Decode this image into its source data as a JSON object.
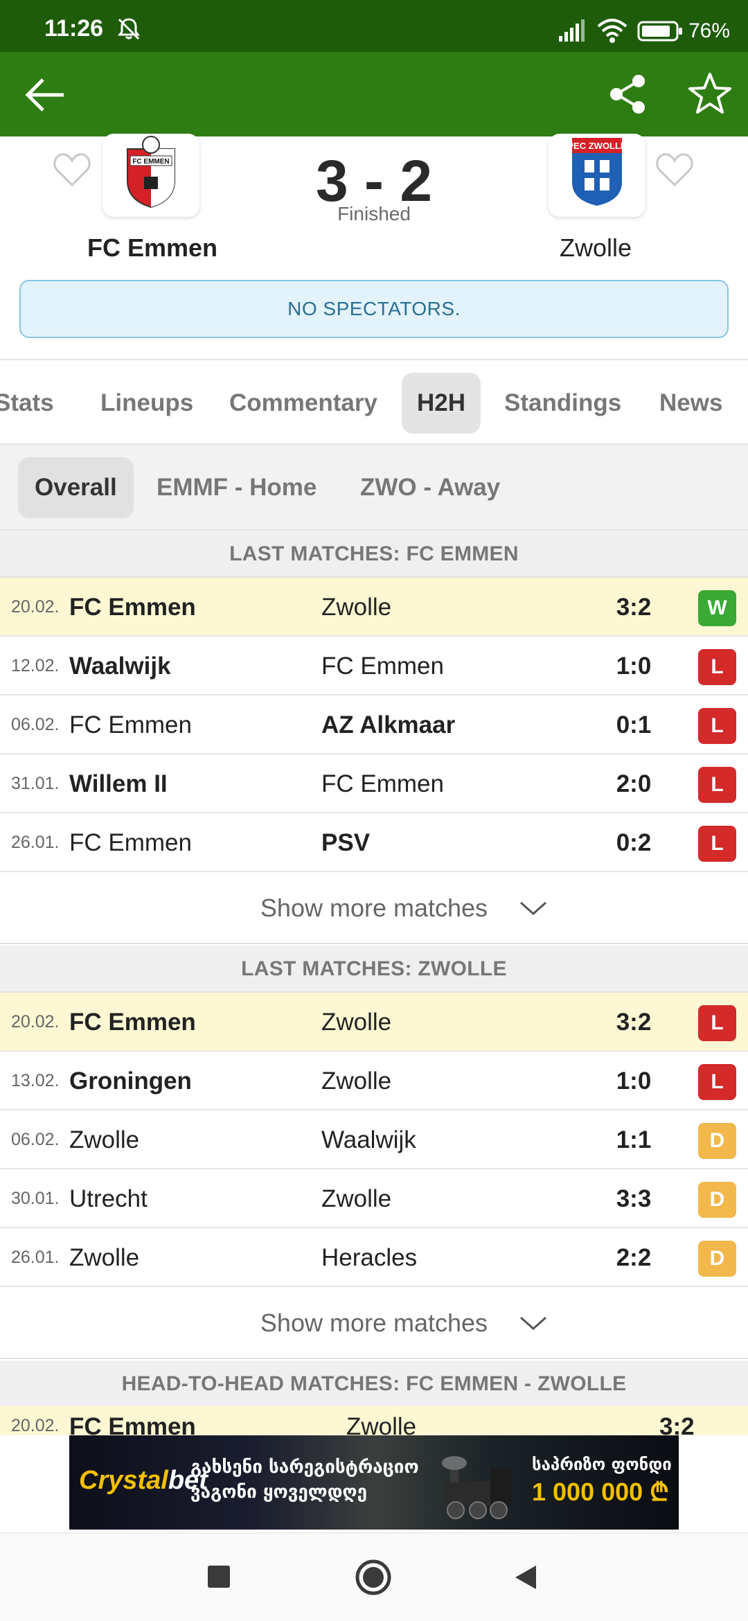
{
  "status_bar": {
    "time": "11:26",
    "battery": "76%",
    "icons": [
      "mute-icon",
      "signal-icon",
      "wifi-icon",
      "battery-icon"
    ]
  },
  "app_bar": {
    "icons": [
      "back-arrow-icon",
      "share-icon",
      "star-icon"
    ]
  },
  "match": {
    "home_team": "FC Emmen",
    "away_team": "Zwolle",
    "score": "3 - 2",
    "status": "Finished",
    "home_logo_text": "FC EMMEN",
    "away_logo_text": "PEC ZWOLLE",
    "notice": "NO SPECTATORS."
  },
  "tabs": [
    {
      "label": "Stats"
    },
    {
      "label": "Lineups"
    },
    {
      "label": "Commentary"
    },
    {
      "label": "H2H",
      "active": true
    },
    {
      "label": "Standings"
    },
    {
      "label": "News"
    }
  ],
  "subtabs": [
    {
      "label": "Overall",
      "active": true
    },
    {
      "label": "EMMF - Home"
    },
    {
      "label": "ZWO - Away"
    }
  ],
  "sections": [
    {
      "title": "LAST MATCHES: FC EMMEN",
      "show_more": "Show more matches",
      "rows": [
        {
          "date": "20.02.",
          "home": "FC Emmen",
          "away": "Zwolle",
          "score": "3:2",
          "result": "W",
          "winner": "home",
          "highlight": true
        },
        {
          "date": "12.02.",
          "home": "Waalwijk",
          "away": "FC Emmen",
          "score": "1:0",
          "result": "L",
          "winner": "home"
        },
        {
          "date": "06.02.",
          "home": "FC Emmen",
          "away": "AZ Alkmaar",
          "score": "0:1",
          "result": "L",
          "winner": "away"
        },
        {
          "date": "31.01.",
          "home": "Willem II",
          "away": "FC Emmen",
          "score": "2:0",
          "result": "L",
          "winner": "home"
        },
        {
          "date": "26.01.",
          "home": "FC Emmen",
          "away": "PSV",
          "score": "0:2",
          "result": "L",
          "winner": "away"
        }
      ]
    },
    {
      "title": "LAST MATCHES: ZWOLLE",
      "show_more": "Show more matches",
      "rows": [
        {
          "date": "20.02.",
          "home": "FC Emmen",
          "away": "Zwolle",
          "score": "3:2",
          "result": "L",
          "winner": "home",
          "highlight": true
        },
        {
          "date": "13.02.",
          "home": "Groningen",
          "away": "Zwolle",
          "score": "1:0",
          "result": "L",
          "winner": "home"
        },
        {
          "date": "06.02.",
          "home": "Zwolle",
          "away": "Waalwijk",
          "score": "1:1",
          "result": "D",
          "winner": "none"
        },
        {
          "date": "30.01.",
          "home": "Utrecht",
          "away": "Zwolle",
          "score": "3:3",
          "result": "D",
          "winner": "none"
        },
        {
          "date": "26.01.",
          "home": "Zwolle",
          "away": "Heracles",
          "score": "2:2",
          "result": "D",
          "winner": "none"
        }
      ]
    },
    {
      "title": "HEAD-TO-HEAD MATCHES: FC EMMEN - ZWOLLE",
      "rows": [
        {
          "date": "20.02.",
          "home": "FC Emmen",
          "away": "Zwolle",
          "score": "3:2",
          "partial": true
        }
      ]
    }
  ],
  "result_colors": {
    "W": "#3aa935",
    "L": "#d42a2a",
    "D": "#f2b84b"
  },
  "ad": {
    "brand_part1": "Crystal",
    "brand_part2": "bet",
    "line1": "გახსენი სარეგისტრაციო",
    "line2": "ვაგონი ყოველდღე",
    "right_line1": "საპრიზო ფონდი",
    "right_amount": "1 000 000 ₾"
  },
  "colors": {
    "status_bar": "#1e5c0a",
    "app_bar": "#2e7d13",
    "highlight_row": "#fdf8d3",
    "notice_bg": "#e3f3fb"
  }
}
